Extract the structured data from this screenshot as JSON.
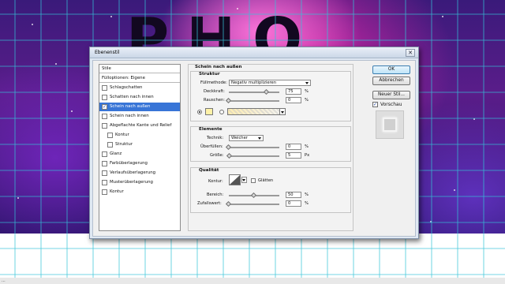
{
  "canvas": {
    "letters": "PHO"
  },
  "dialog": {
    "title": "Ebenenstil",
    "close_glyph": "✕",
    "styles_list": {
      "header_label": "Stile",
      "fill_options_label": "Fülloptionen: Eigene",
      "items": [
        {
          "label": "Schlagschatten",
          "checked": false,
          "indent": false
        },
        {
          "label": "Schatten nach innen",
          "checked": false,
          "indent": false
        },
        {
          "label": "Schein nach außen",
          "checked": true,
          "indent": false,
          "selected": true
        },
        {
          "label": "Schein nach innen",
          "checked": false,
          "indent": false
        },
        {
          "label": "Abgeflachte Kante und Relief",
          "checked": false,
          "indent": false
        },
        {
          "label": "Kontur",
          "checked": false,
          "indent": true
        },
        {
          "label": "Struktur",
          "checked": false,
          "indent": true
        },
        {
          "label": "Glanz",
          "checked": false,
          "indent": false
        },
        {
          "label": "Farbüberlagerung",
          "checked": false,
          "indent": false
        },
        {
          "label": "Verlaufsüberlagerung",
          "checked": false,
          "indent": false
        },
        {
          "label": "Musterüberlagerung",
          "checked": false,
          "indent": false
        },
        {
          "label": "Kontur",
          "checked": false,
          "indent": false
        }
      ],
      "check_glyph": "✓"
    },
    "panel": {
      "title": "Schein nach außen",
      "struktur": {
        "title": "Struktur",
        "blend_mode_label": "Füllmethode:",
        "blend_mode_value": "Negativ multiplizieren",
        "opacity_label": "Deckkraft:",
        "opacity_value": "75",
        "opacity_fraction": 0.75,
        "opacity_unit": "%",
        "noise_label": "Rauschen:",
        "noise_value": "0",
        "noise_fraction": 0,
        "noise_unit": "%",
        "color_swatch": "#fff2a8",
        "color_radio_selected": "solid"
      },
      "elemente": {
        "title": "Elemente",
        "technique_label": "Technik:",
        "technique_value": "Weicher",
        "spread_label": "Überfüllen:",
        "spread_value": "0",
        "spread_fraction": 0,
        "spread_unit": "%",
        "size_label": "Größe:",
        "size_value": "5",
        "size_fraction": 0.02,
        "size_unit": "Px"
      },
      "qualitaet": {
        "title": "Qualität",
        "contour_label": "Kontur:",
        "antialias_label": "Glätten",
        "antialias_checked": false,
        "range_label": "Bereich:",
        "range_value": "50",
        "range_fraction": 0.5,
        "range_unit": "%",
        "jitter_label": "Zufallswert:",
        "jitter_value": "0",
        "jitter_fraction": 0,
        "jitter_unit": "%"
      }
    },
    "buttons": {
      "ok": "OK",
      "cancel": "Abbrechen",
      "new_style": "Neuer Stil...",
      "preview_label": "Vorschau",
      "preview_checked": true
    }
  },
  "status_bar": {
    "text": "..."
  },
  "colors": {
    "selection": "#3875d7",
    "guides": "#34c3d8",
    "default_button": "#bfe4f8"
  }
}
